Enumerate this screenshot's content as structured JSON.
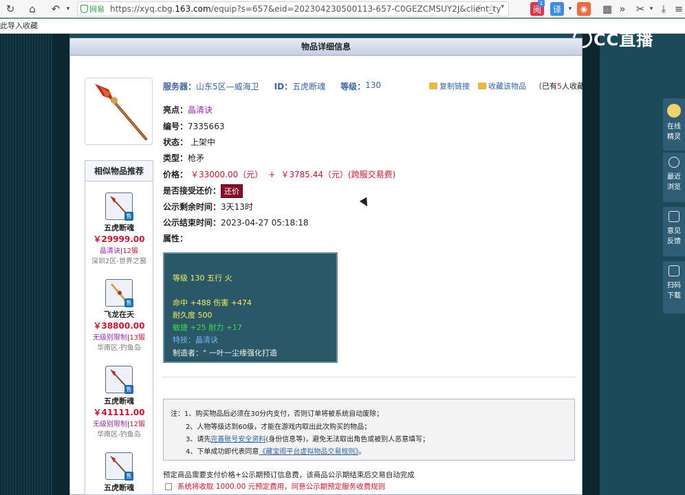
{
  "browser": {
    "safe_label": "网易",
    "url_prefix": "https://xyq.cbg.",
    "url_domain": "163.com",
    "url_rest": "/equip?s=657&eid=202304230500113-657-C0GEZCMSUY2J&client_ty",
    "bookmark_bar_text": "此导入收藏",
    "ext_badge": "1"
  },
  "watermark": "CC直播",
  "panel": {
    "title": "物品详细信息"
  },
  "meta": {
    "server_label": "服务器：",
    "server": "山东5区—威海卫",
    "id_label": "ID：",
    "id": "五虎断魂",
    "level_label": "等级：",
    "level": "130",
    "copy_link": "复制链接",
    "fav_item": "收藏该物品",
    "fav_prefix": "（已有",
    "fav_count": "5",
    "fav_suffix": "人收藏）"
  },
  "details": {
    "highlight_label": "亮点：",
    "highlight": "晶清诀",
    "serial_label": "编号：",
    "serial": "7335663",
    "status_label": "状态：",
    "status": "上架中",
    "type_label": "类型：",
    "type": "枪矛",
    "price_label": "价格：",
    "price": "￥33000.00（元）",
    "price_plus": "+",
    "fee": "￥3785.44（元）(跨服交易费)",
    "counter_label": "是否接受还价：",
    "counter_btn": "还价",
    "remain_label": "公示剩余时间：",
    "remain": "3天13时",
    "end_label": "公示结束时间：",
    "end": "2023-04-27 05:18:18",
    "attr_label": "属性："
  },
  "attributes": {
    "line1": "等级 130  五行 火",
    "line2": "命中 +488 伤害 +474",
    "line3": "耐久度 500",
    "line4": "敏捷 +25 耐力 +17",
    "line5": "特技：晶清诀",
    "line6": "制造者：° 一叶一尘缘强化打造"
  },
  "recommend": {
    "title": "相似物品推荐",
    "sell_badge": "售",
    "items": [
      {
        "name": "五虎断魂",
        "price": "￥29999.00",
        "tag": "晶清诀",
        "sep": "|",
        "level": "12锻",
        "server": "深圳2区-世界之窗"
      },
      {
        "name": "飞龙在天",
        "price": "￥38800.00",
        "tag": "无级别限制",
        "sep": "|",
        "level": "13锻",
        "server": "华南区-钓鱼岛"
      },
      {
        "name": "五虎断魂",
        "price": "￥41111.00",
        "tag": "无级别限制",
        "sep": "|",
        "level": "12锻",
        "server": "华南区-钓鱼岛"
      },
      {
        "name": "五虎断魂"
      }
    ]
  },
  "notice": {
    "l1": "注：1、购买物品后必须在30分内支付，否则订单将被系统自动废除；",
    "l2": "2、人物等级达到60级，才能在游戏内取出此次购买的物品；",
    "l3a": "3、请先",
    "l3link": "完善账号安全资料",
    "l3b": "(身份信息等)，避免无法取出角色或被别人恶意填写；",
    "l4a": "4、下单成功即代表同意",
    "l4link": "《藏宝阁平台虚拟物品交易规则》",
    "l4b": "。"
  },
  "bottom": {
    "line1": "预定商品需要支付价格+公示期预订信息费，该商品公示期结束后交易自动完成",
    "line2": "系统将收取 1000.00 元预定费用，同意公示期预定服务收费规则"
  },
  "float_bar": {
    "online": "在线精灵",
    "recent": "最近浏览",
    "feedback": "意见反馈",
    "scan": "扫码下载"
  }
}
